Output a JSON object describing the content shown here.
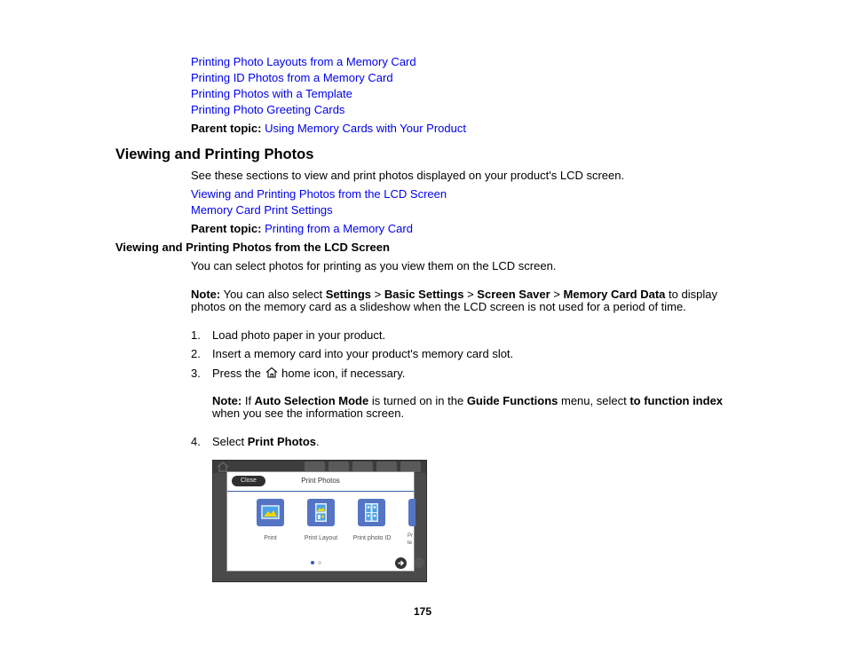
{
  "top_links": [
    "Printing Photo Layouts from a Memory Card",
    "Printing ID Photos from a Memory Card",
    "Printing Photos with a Template",
    "Printing Photo Greeting Cards"
  ],
  "parent_topic_1": {
    "label": "Parent topic:",
    "link": "Using Memory Cards with Your Product"
  },
  "section": {
    "title": "Viewing and Printing Photos",
    "intro": "See these sections to view and print photos displayed on your product's LCD screen.",
    "links": [
      "Viewing and Printing Photos from the LCD Screen",
      "Memory Card Print Settings"
    ],
    "parent_topic": {
      "label": "Parent topic:",
      "link": "Printing from a Memory Card"
    }
  },
  "subsection": {
    "title": "Viewing and Printing Photos from the LCD Screen",
    "intro": "You can select photos for printing as you view them on the LCD screen.",
    "note1": {
      "label": "Note:",
      "t1": " You can also select ",
      "b1": "Settings",
      "t2": " > ",
      "b2": "Basic Settings",
      "t3": " > ",
      "b3": "Screen Saver",
      "t4": " > ",
      "b4": "Memory Card Data",
      "t5": " to display",
      "line2": "photos on the memory card as a slideshow when the LCD screen is not used for a period of time."
    },
    "steps": [
      {
        "num": "1.",
        "text": "Load photo paper in your product."
      },
      {
        "num": "2.",
        "text": "Insert a memory card into your product's memory card slot."
      },
      {
        "num": "3.",
        "pre": "Press the ",
        "icon": "home-icon",
        "post": " home icon, if necessary."
      },
      {
        "num": "4.",
        "pre": "Select ",
        "bold": "Print Photos",
        "post": "."
      }
    ],
    "note2": {
      "label": "Note:",
      "t1": " If ",
      "b1": "Auto Selection Mode",
      "t2": " is turned on in the ",
      "b2": "Guide Functions",
      "t3": " menu, select ",
      "b3": "to function index",
      "line2": "when you see the information screen."
    }
  },
  "lcd_screen": {
    "close_label": "Close",
    "title": "Print Photos",
    "items": [
      "Print",
      "Print Layout",
      "Print photo ID",
      "Pr te"
    ],
    "page_indicator": {
      "current": 1,
      "total": 2
    },
    "colors": {
      "tile": "#5674c4",
      "accent": "#f2d500",
      "dot_active": "#2f5bb7"
    }
  },
  "page_number": "175"
}
